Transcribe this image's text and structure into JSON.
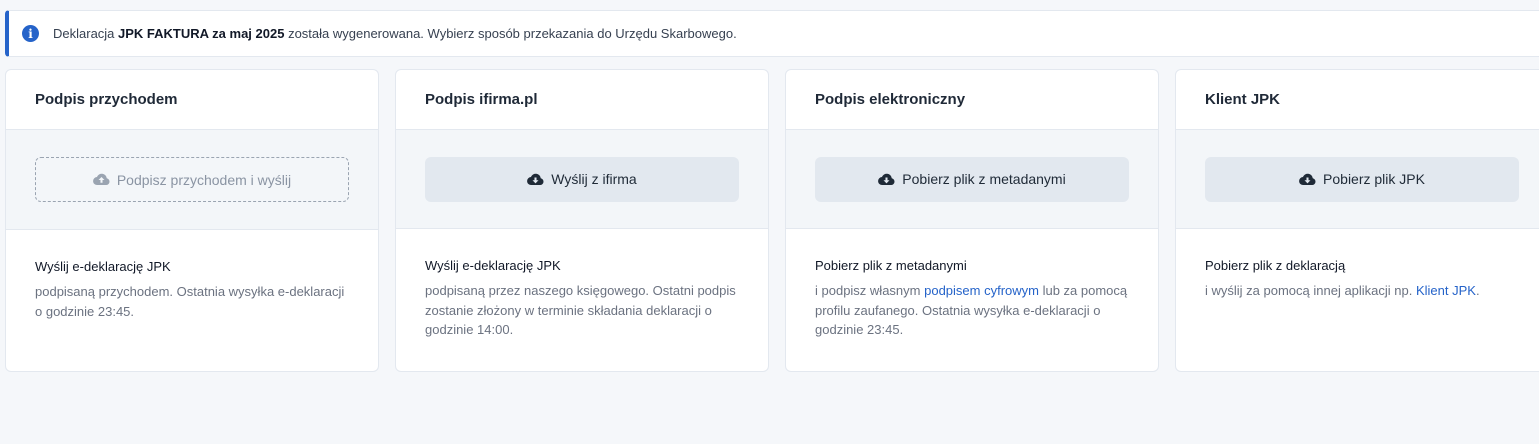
{
  "alert": {
    "icon": "info-icon",
    "text_prefix": "Deklaracja ",
    "text_bold": "JPK FAKTURA za maj 2025",
    "text_suffix": " została wygenerowana. Wybierz sposób przekazania do Urzędu Skarbowego."
  },
  "cards": [
    {
      "title": "Podpis przychodem",
      "button_label": "Podpisz przychodem i wyślij",
      "body_title": "Wyślij e-deklarację JPK",
      "body_text": "podpisaną przychodem. Ostatnia wysyłka e-deklaracji o godzinie 23:45."
    },
    {
      "title": "Podpis ifirma.pl",
      "button_label": "Wyślij z ifirma",
      "body_title": "Wyślij e-deklarację JPK",
      "body_text": "podpisaną przez naszego księgowego. Ostatni podpis zostanie złożony w terminie składania deklaracji o godzinie 14:00."
    },
    {
      "title": "Podpis elektroniczny",
      "button_label": "Pobierz plik z metadanymi",
      "body_title": "Pobierz plik z metadanymi",
      "body_text_before": "i podpisz własnym ",
      "body_link": "podpisem cyfrowym",
      "body_text_after": " lub za pomocą profilu zaufanego. Ostatnia wysyłka e-deklaracji o godzinie 23:45."
    },
    {
      "title": "Klient JPK",
      "button_label": "Pobierz plik JPK",
      "body_title": "Pobierz plik z deklaracją",
      "body_text_before": "i wyślij za pomocą innej aplikacji np. ",
      "body_link": "Klient JPK",
      "body_text_after": "."
    }
  ],
  "colors": {
    "accent": "#2563c9",
    "button_bg": "#e2e8ef",
    "action_bg": "#f3f6f9"
  }
}
